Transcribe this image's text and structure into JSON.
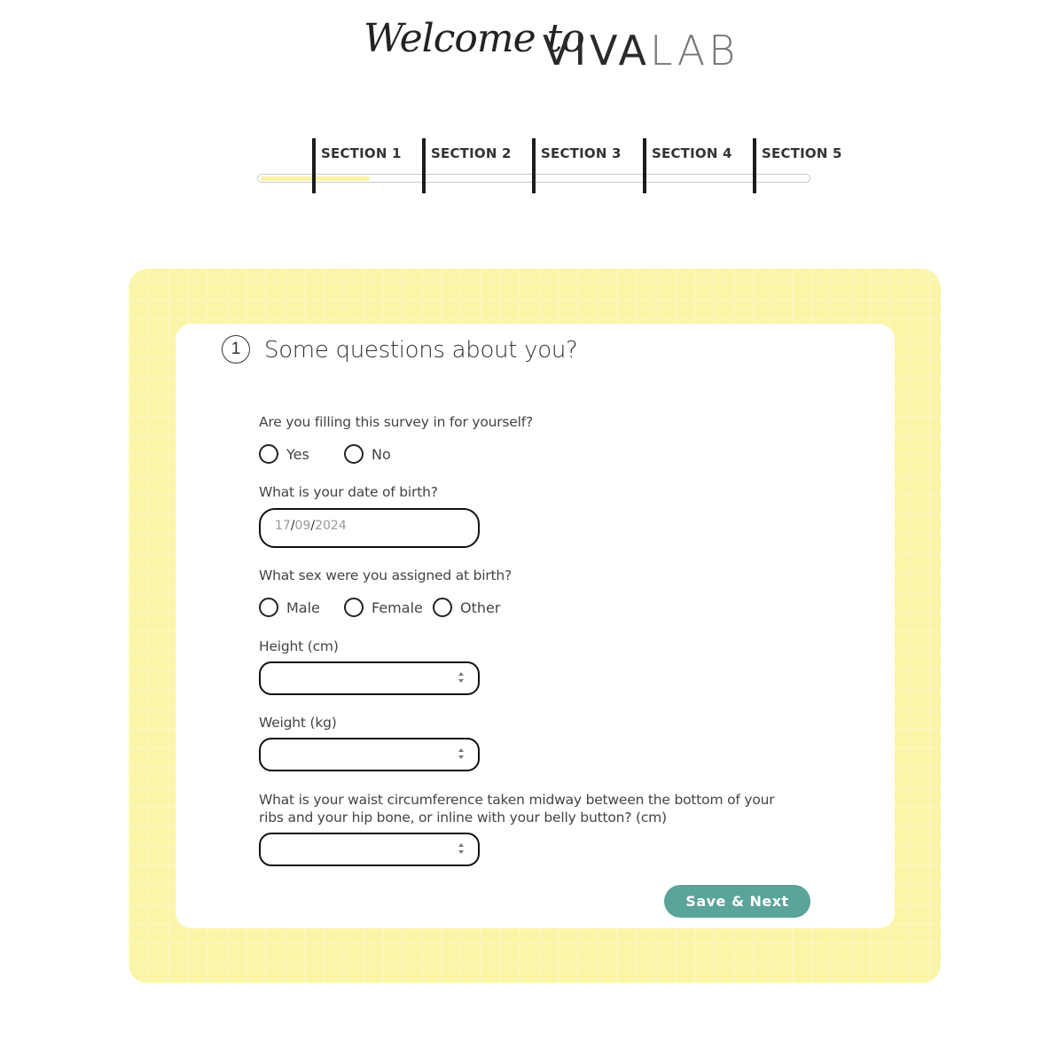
{
  "header": {
    "script_text": "Welcome to",
    "brand_viva": "VIVA",
    "brand_lab": "LAB"
  },
  "progress": {
    "sections": [
      "SECTION 1",
      "SECTION 2",
      "SECTION 3",
      "SECTION 4",
      "SECTION 5"
    ],
    "fill_fraction": 0.2
  },
  "form": {
    "step_number": "1",
    "title": "Some questions about you?",
    "q_self": "Are you filling this survey in for yourself?",
    "self_options": [
      "Yes",
      "No"
    ],
    "q_dob": "What is your date of birth?",
    "dob_day": "17",
    "dob_month": "09",
    "dob_year": "2024",
    "dob_sep": "/",
    "q_sex": "What sex were you assigned at birth?",
    "sex_options": [
      "Male",
      "Female",
      "Other"
    ],
    "q_height": "Height (cm)",
    "q_weight": "Weight (kg)",
    "q_waist": "What is your waist circumference taken midway between the bottom of your ribs and your hip bone, or inline with your belly button? (cm)",
    "save_label": "Save & Next"
  },
  "colors": {
    "accent": "#5aa49a",
    "card_bg": "#fbf5a8",
    "progress_fill": "#faf3a3"
  }
}
